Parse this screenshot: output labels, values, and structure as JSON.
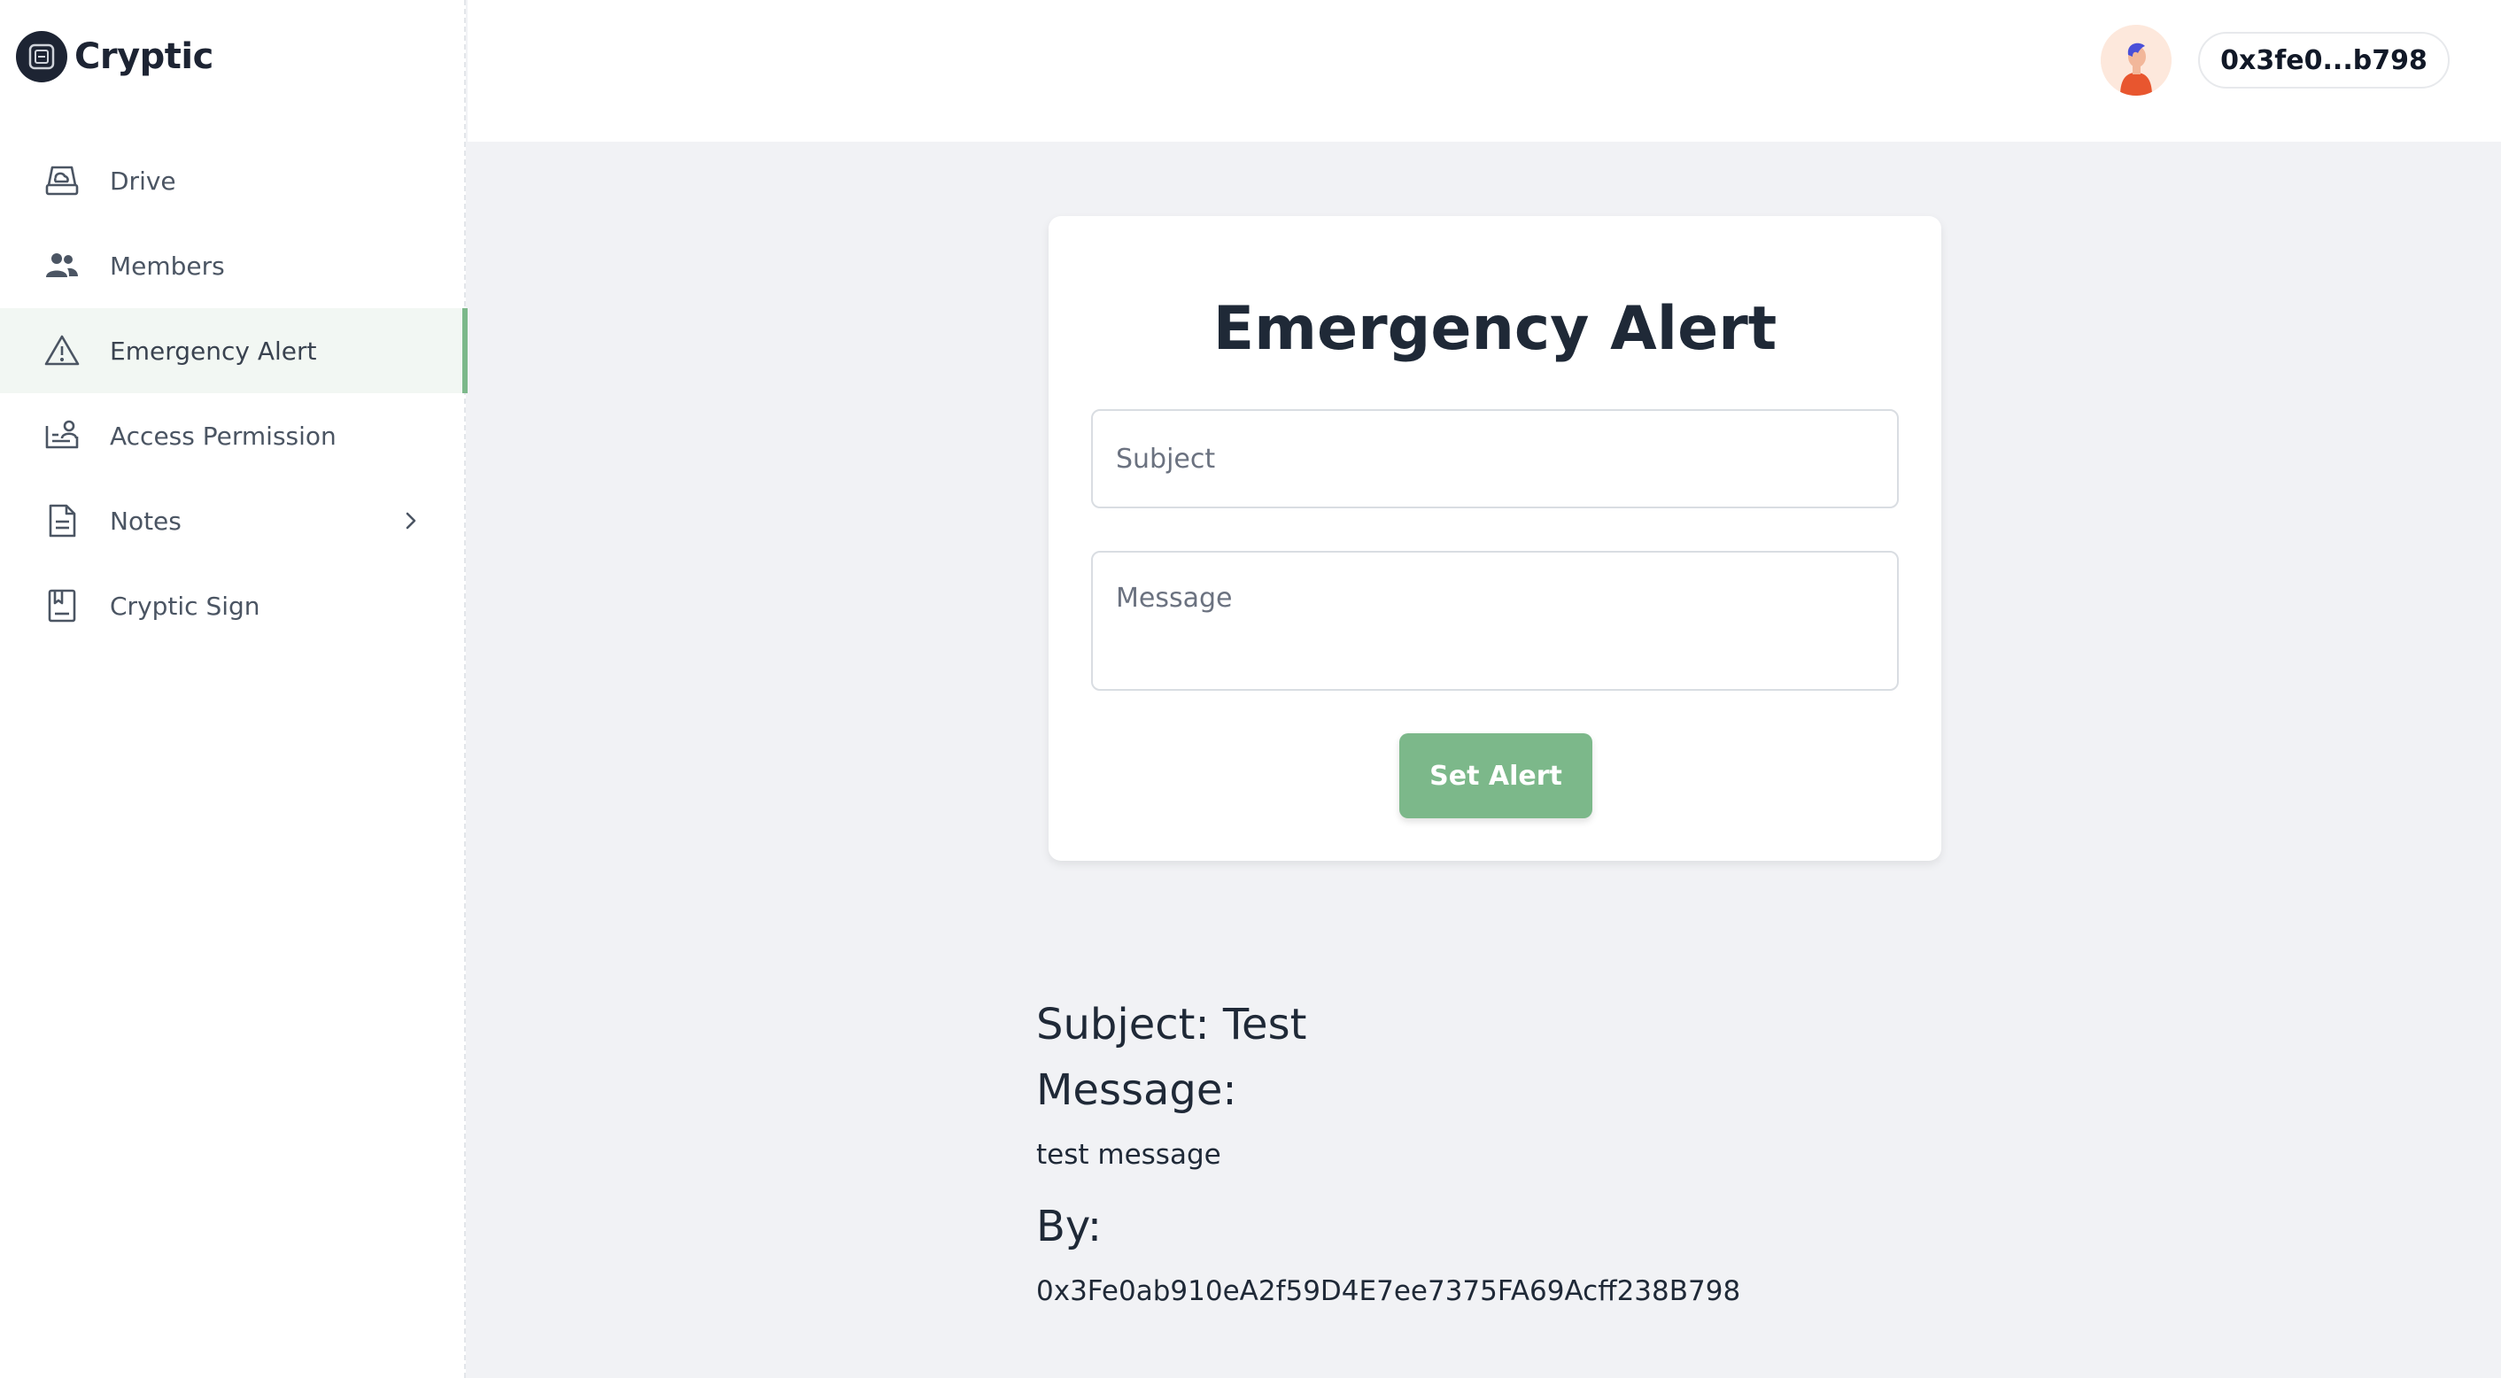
{
  "app": {
    "name": "Cryptic"
  },
  "sidebar": {
    "items": [
      {
        "label": "Drive",
        "icon": "drive-icon"
      },
      {
        "label": "Members",
        "icon": "members-icon"
      },
      {
        "label": "Emergency Alert",
        "icon": "warning-icon",
        "active": true
      },
      {
        "label": "Access Permission",
        "icon": "access-permission-icon"
      },
      {
        "label": "Notes",
        "icon": "notes-icon",
        "has_submenu": true
      },
      {
        "label": "Cryptic Sign",
        "icon": "sign-document-icon"
      }
    ]
  },
  "topbar": {
    "wallet_short": "0x3fe0...b798"
  },
  "form": {
    "title": "Emergency Alert",
    "subject_placeholder": "Subject",
    "message_placeholder": "Message",
    "submit_label": "Set Alert"
  },
  "alert": {
    "subject_line": "Subject: Test",
    "message_heading": "Message:",
    "message": "test message",
    "by_heading": "By:",
    "by_address": "0x3Fe0ab910eA2f59D4E7ee7375FA69Acff238B798"
  },
  "colors": {
    "accent": "#7cb88a",
    "background": "#f1f2f5",
    "text": "#1f2937"
  }
}
